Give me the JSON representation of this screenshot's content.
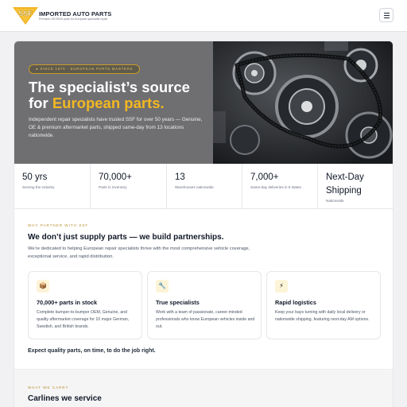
{
  "header": {
    "brand_name": "IMPORTED AUTO PARTS",
    "brand_tagline": "Premium OE/OEM parts for European specialist repair",
    "logo_text": "SSF",
    "menu_icon": "hamburger-icon"
  },
  "hero": {
    "badge": "● SINCE 1970 · EUROPEAN PARTS MASTERS",
    "title_line1": "The specialist’s source",
    "title_prefix": "for ",
    "title_accent": "European parts.",
    "description": "Independent repair specialists have trusted SSF for over 50 years — Genuine, OE & premium aftermarket parts, shipped same-day from 13 locations nationwide.",
    "image_alt": "engine belt and pulleys"
  },
  "stats": [
    {
      "value": "50 yrs",
      "label": "Serving the industry"
    },
    {
      "value": "70,000+",
      "label": "Parts in inventory"
    },
    {
      "value": "13",
      "label": "Warehouses nationwide"
    },
    {
      "value": "7,000+",
      "label": "Same-day deliveries in 6 states"
    },
    {
      "value": "Next-Day Shipping",
      "label": "Nationwide"
    }
  ],
  "partner": {
    "eyebrow": "WHY PARTNER WITH SSF",
    "title": "We don’t just supply parts — we build partnerships.",
    "description": "We’re dedicated to helping European repair specialists thrive with the most comprehensive vehicle coverage, exceptional service, and rapid distribution.",
    "features": [
      {
        "icon": "box-icon",
        "glyph": "📦",
        "title": "70,000+ parts in stock",
        "description": "Complete bumper-to-bumper OEM, Genuine, and quality aftermarket coverage for 10 major German, Swedish, and British brands."
      },
      {
        "icon": "wrench-icon",
        "glyph": "🔧",
        "title": "True specialists",
        "description": "Work with a team of passionate, career-minded professionals who know European vehicles inside and out."
      },
      {
        "icon": "lightning-icon",
        "glyph": "⚡",
        "title": "Rapid logistics",
        "description": "Keep your bays turning with daily local delivery or nationwide shipping, featuring next-day AM options."
      }
    ],
    "tagline": "Expect quality parts, on time, to do the job right."
  },
  "carry": {
    "eyebrow": "WHAT WE CARRY",
    "title": "Carlines we service"
  },
  "colors": {
    "accent": "#f3b722",
    "hero_bg": "#6f6f71",
    "text_dark": "#111827"
  }
}
